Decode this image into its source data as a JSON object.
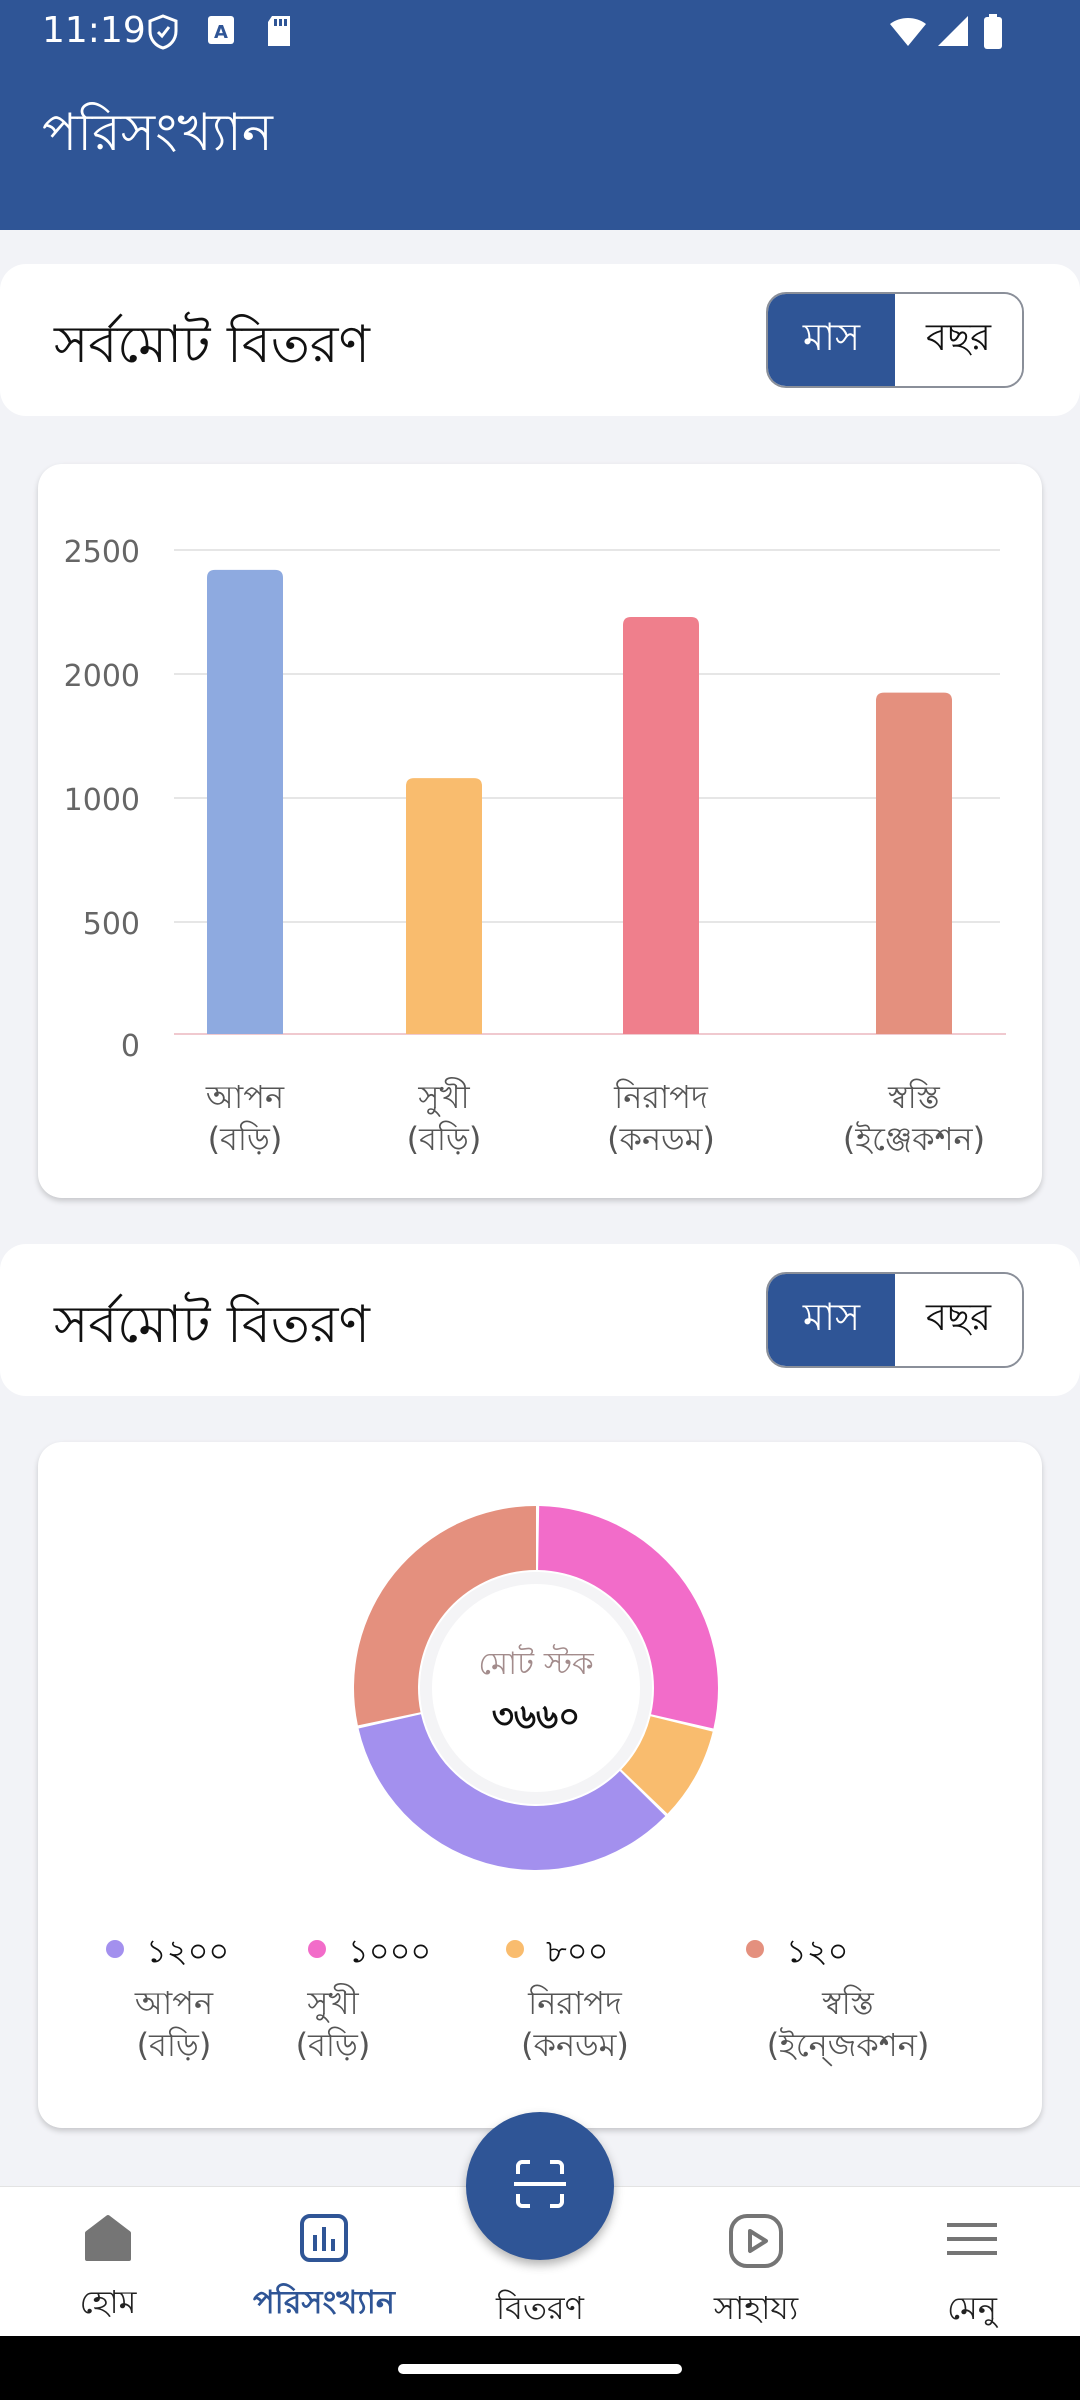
{
  "status_bar": {
    "time": "11:19"
  },
  "app_bar": {
    "title": "পরিসংখ্যান"
  },
  "section1": {
    "title": "সর্বমোট বিতরণ",
    "toggle": {
      "month": "মাস",
      "year": "বছর",
      "selected": "মাস"
    }
  },
  "bar_chart": {
    "y_ticks": [
      "2500",
      "2000",
      "1000",
      "500",
      "0"
    ],
    "categories": [
      {
        "line1": "আপন",
        "line2": "(বড়ি)"
      },
      {
        "line1": "সুখী",
        "line2": "(বড়ি)"
      },
      {
        "line1": "নিরাপদ",
        "line2": "(কনডম)"
      },
      {
        "line1": "স্বস্তি",
        "line2": "(ইঞ্জেকশন)"
      }
    ]
  },
  "section2": {
    "title": "সর্বমোট বিতরণ",
    "toggle": {
      "month": "মাস",
      "year": "বছর",
      "selected": "মাস"
    }
  },
  "donut": {
    "center_label": "মোট স্টক",
    "center_value": "৩৬৬০",
    "legend": [
      {
        "value": "১২০০",
        "line1": "আপন",
        "line2": "(বড়ি)",
        "color": "#a390ee"
      },
      {
        "value": "১০০০",
        "line1": "সুখী",
        "line2": "(বড়ি)",
        "color": "#f26cc9"
      },
      {
        "value": "৮০০",
        "line1": "নিরাপদ",
        "line2": "(কনডম)",
        "color": "#f9bc6e"
      },
      {
        "value": "১২০",
        "line1": "স্বস্তি",
        "line2": "(ইন্জেকশন)",
        "color": "#e4907e"
      }
    ]
  },
  "bottom_nav": {
    "items": [
      {
        "label": "হোম",
        "icon": "home-icon"
      },
      {
        "label": "পরিসংখ্যান",
        "icon": "bar-chart-icon",
        "active": true
      },
      {
        "label": "বিতরণ",
        "icon": "scan-icon"
      },
      {
        "label": "সাহায্য",
        "icon": "play-icon"
      },
      {
        "label": "মেনু",
        "icon": "menu-icon"
      }
    ]
  },
  "chart_data": [
    {
      "type": "bar",
      "categories": [
        "আপন (বড়ি)",
        "সুখী (বড়ি)",
        "নিরাপদ (কনডম)",
        "স্বস্তি (ইঞ্জেকশন)"
      ],
      "values": [
        2420,
        1160,
        2230,
        1850
      ],
      "ytick_labels": [
        "0",
        "500",
        "1000",
        "2000",
        "2500"
      ],
      "ylim": [
        0,
        2500
      ],
      "colors": [
        "#8eaae0",
        "#f9bc6e",
        "#ef7f8c",
        "#e4907e"
      ],
      "grid": true
    },
    {
      "type": "pie",
      "labels": [
        "আপন (বড়ি)",
        "সুখী (বড়ি)",
        "নিরাপদ (কনডম)",
        "স্বস্তি (ইন্জেকশন)"
      ],
      "values": [
        1200,
        1000,
        800,
        120
      ],
      "colors": [
        "#a390ee",
        "#f26cc9",
        "#f9bc6e",
        "#e4907e"
      ]
    }
  ]
}
